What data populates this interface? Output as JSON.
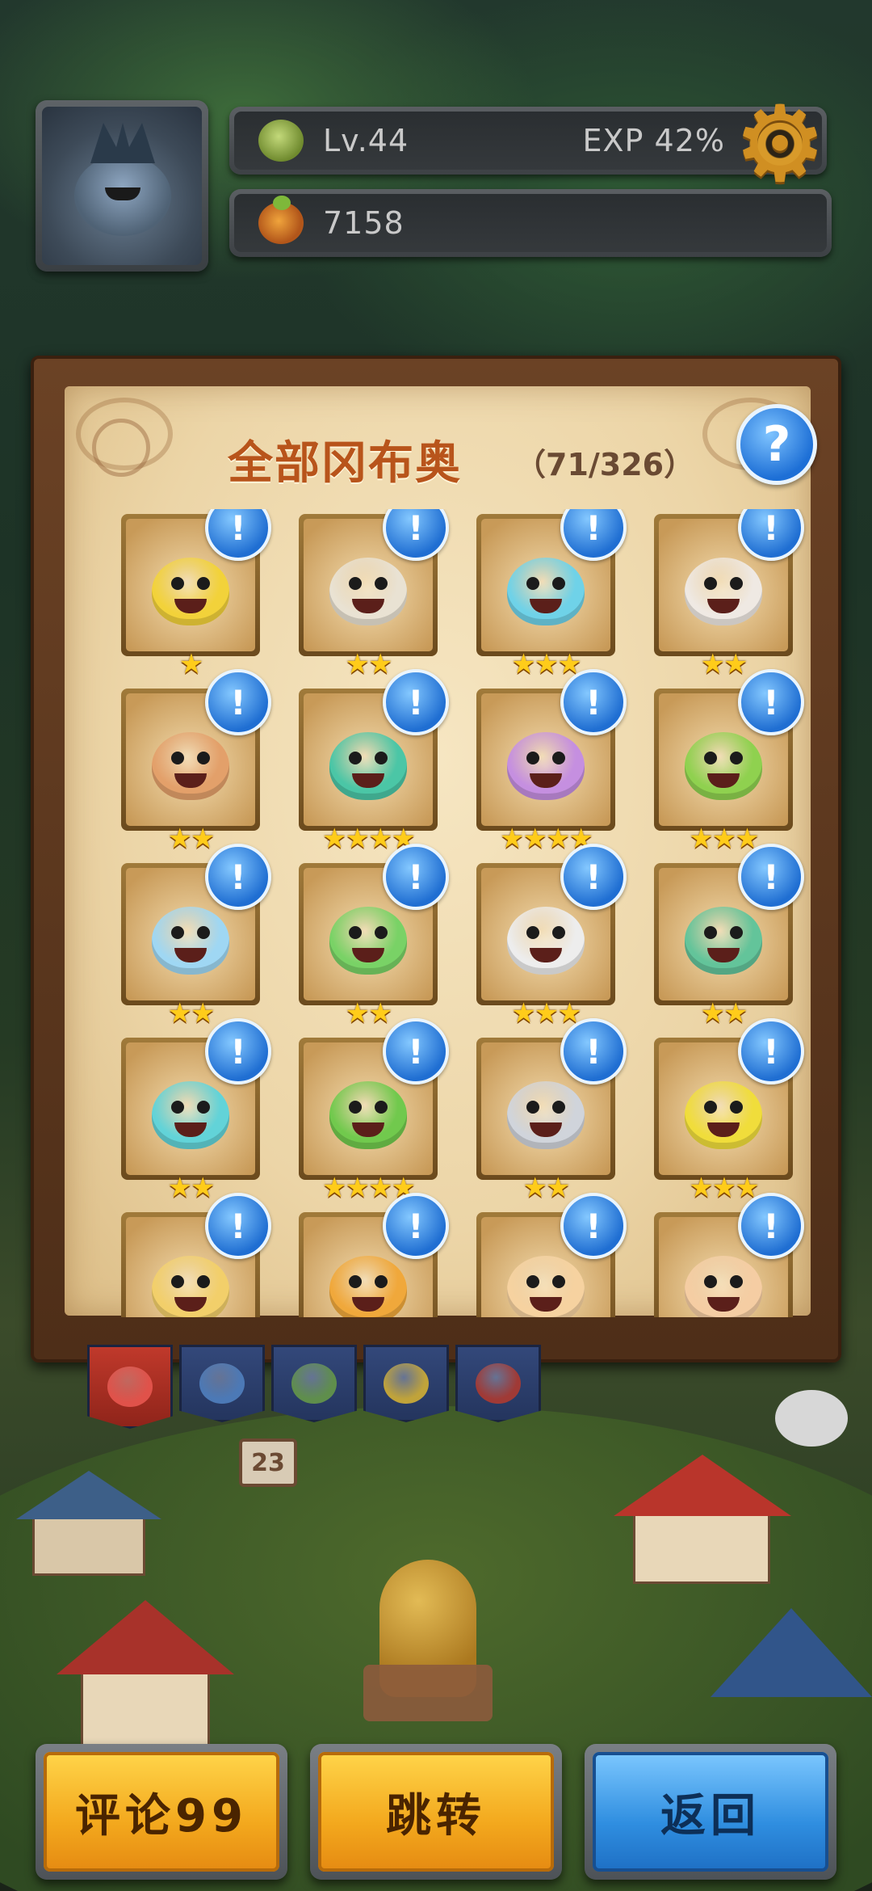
{
  "hud": {
    "level": "Lv.44",
    "exp": "EXP 42%",
    "coins": "7158"
  },
  "collection": {
    "title": "全部冈布奥",
    "count": "（71/326）",
    "help_icon": "question-icon"
  },
  "cards": [
    {
      "stars": "★",
      "color": "#f2d23a"
    },
    {
      "stars": "★★",
      "color": "#e9e2d3"
    },
    {
      "stars": "★★★",
      "color": "#6fd2e8"
    },
    {
      "stars": "★★",
      "color": "#efe9e3"
    },
    {
      "stars": "★★",
      "color": "#e3a06a"
    },
    {
      "stars": "★★★★",
      "color": "#4bc6a6"
    },
    {
      "stars": "★★★★",
      "color": "#c58fe0"
    },
    {
      "stars": "★★★",
      "color": "#8fd14f"
    },
    {
      "stars": "★★",
      "color": "#9fd7f3"
    },
    {
      "stars": "★★",
      "color": "#79d266"
    },
    {
      "stars": "★★★",
      "color": "#ededed"
    },
    {
      "stars": "★★",
      "color": "#63c49a"
    },
    {
      "stars": "★★",
      "color": "#62d3d8"
    },
    {
      "stars": "★★★★",
      "color": "#71c94d"
    },
    {
      "stars": "★★",
      "color": "#d0d4db"
    },
    {
      "stars": "★★★",
      "color": "#f0dd3b"
    },
    {
      "stars": "",
      "color": "#f2cf6a"
    },
    {
      "stars": "",
      "color": "#f0a83b"
    },
    {
      "stars": "",
      "color": "#f6d2a0"
    },
    {
      "stars": "",
      "color": "#f5cda3"
    }
  ],
  "tabs": [
    {
      "name": "all",
      "color": "#e0524a"
    },
    {
      "name": "blue",
      "color": "#4c79b6"
    },
    {
      "name": "green",
      "color": "#5f8e4c"
    },
    {
      "name": "yellow",
      "color": "#c0a33a"
    },
    {
      "name": "red",
      "color": "#a03a36"
    }
  ],
  "buttons": {
    "comment": "评论99",
    "jump": "跳转",
    "back": "返回"
  },
  "scenery": {
    "signpost": "23"
  }
}
